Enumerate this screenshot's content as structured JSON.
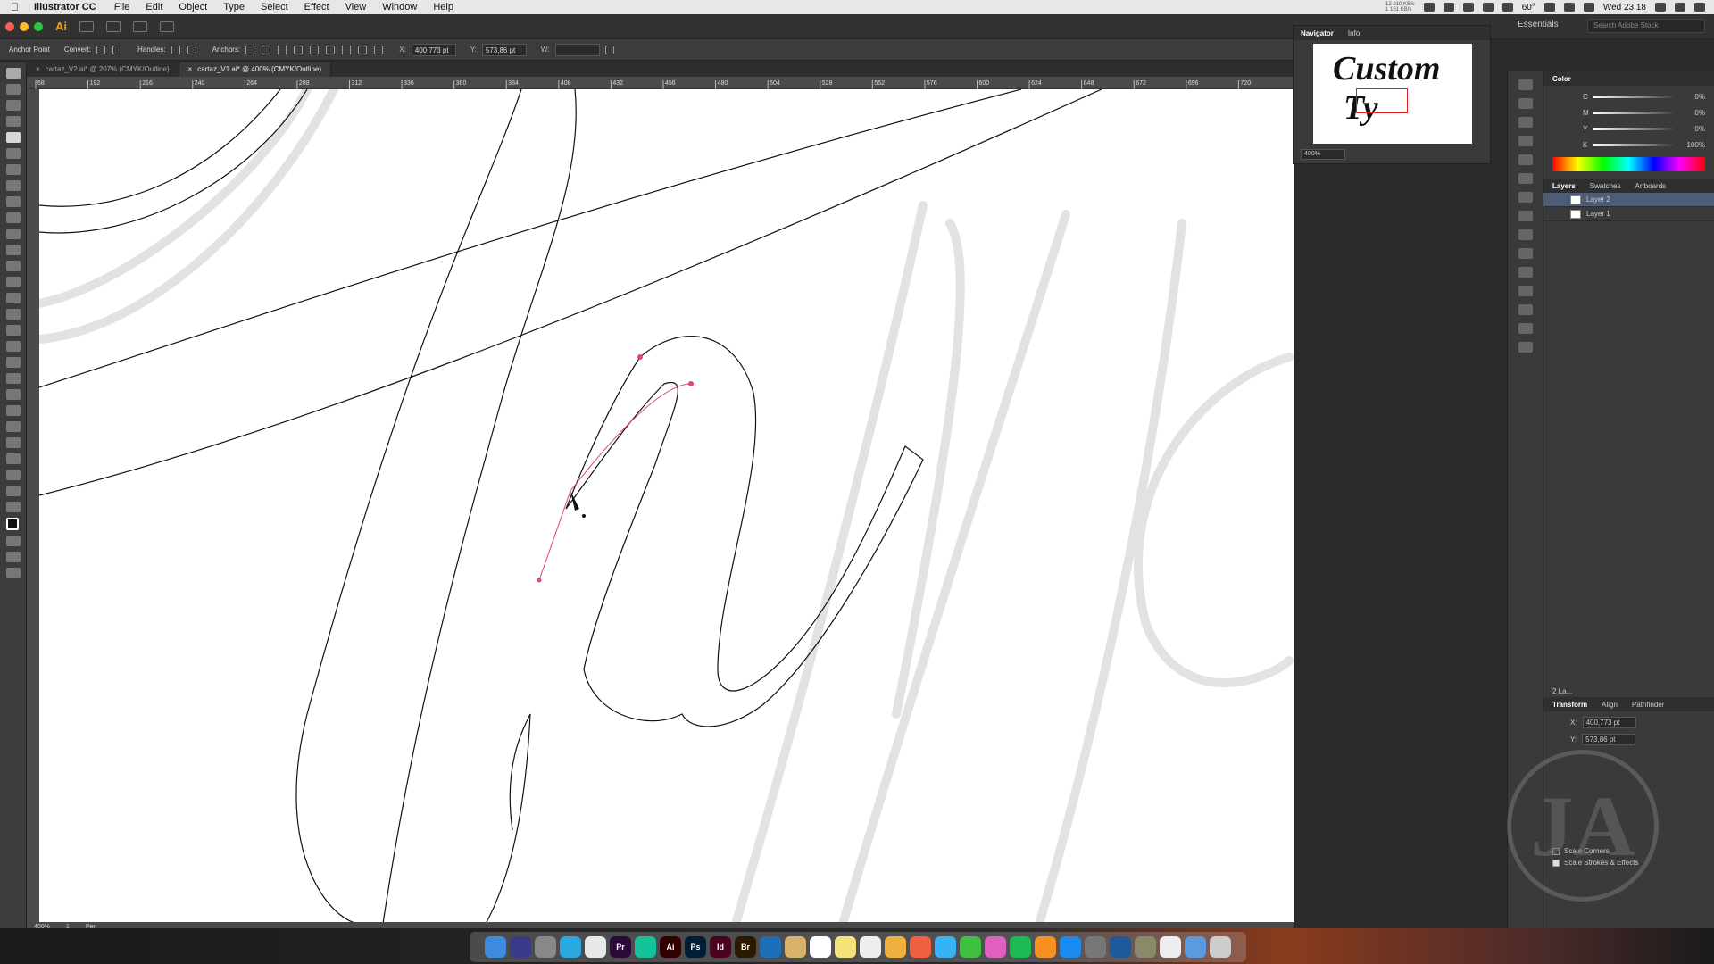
{
  "menubar": {
    "app_name": "Illustrator CC",
    "items": [
      "File",
      "Edit",
      "Object",
      "Type",
      "Select",
      "Effect",
      "View",
      "Window",
      "Help"
    ],
    "clock": "Wed 23:18",
    "temp": "60°",
    "net_up": "12 210 KB/s",
    "net_down": "1 151 KB/s"
  },
  "appbar": {
    "logo": "Ai",
    "workspace": "Essentials",
    "search_placeholder": "Search Adobe Stock"
  },
  "controlbar": {
    "anchor_label": "Anchor Point",
    "convert_label": "Convert:",
    "handles_label": "Handles:",
    "anchors_label": "Anchors:",
    "x_label": "X:",
    "x_value": "400,773 pt",
    "y_label": "Y:",
    "y_value": "573,86 pt",
    "w_label": "W:"
  },
  "tabs": [
    {
      "label": "cartaz_V2.ai* @ 207% (CMYK/Outline)",
      "active": false
    },
    {
      "label": "cartaz_V1.ai* @ 400% (CMYK/Outline)",
      "active": true
    }
  ],
  "ruler": {
    "ticks": [
      "68",
      "192",
      "216",
      "240",
      "264",
      "288",
      "312",
      "336",
      "360",
      "384",
      "408",
      "432",
      "456",
      "480",
      "504",
      "528",
      "552",
      "576",
      "600",
      "624",
      "648",
      "672",
      "696",
      "720"
    ]
  },
  "navigator": {
    "tabs": [
      "Navigator",
      "Info"
    ],
    "preview_text_1": "Custom",
    "preview_text_2": "Ty",
    "zoom": "400%"
  },
  "color_panel": {
    "title": "Color",
    "rows": [
      {
        "label": "C",
        "value": "0"
      },
      {
        "label": "M",
        "value": "0"
      },
      {
        "label": "Y",
        "value": "0"
      },
      {
        "label": "K",
        "value": "100"
      }
    ],
    "percent": "%"
  },
  "layers_panel": {
    "tabs": [
      "Layers",
      "Swatches",
      "Artboards"
    ],
    "layers": [
      {
        "name": "Layer 2",
        "selected": true
      },
      {
        "name": "Layer 1",
        "selected": false
      }
    ],
    "count": "2 La..."
  },
  "transform_panel": {
    "tabs": [
      "Transform",
      "Align",
      "Pathfinder"
    ],
    "x_label": "X:",
    "x_value": "400,773 pt",
    "y_label": "Y:",
    "y_value": "573,86 pt",
    "scale_corners": "Scale Corners",
    "scale_strokes": "Scale Strokes & Effects"
  },
  "statusbar": {
    "zoom": "400%",
    "artboard": "1",
    "tool": "Pen"
  },
  "watermark": {
    "glyph": "JA"
  },
  "colors": {
    "anchor_red": "#e0447a",
    "accent_orange": "#ff9a00",
    "ps_blue": "#2fa3f7",
    "id_pink": "#ff3d8b"
  },
  "dock": [
    {
      "name": "finder-icon",
      "bg": "#3d8bdf",
      "text": ""
    },
    {
      "name": "siri-icon",
      "bg": "#3a3a8a",
      "text": ""
    },
    {
      "name": "launchpad-icon",
      "bg": "#888888",
      "text": ""
    },
    {
      "name": "safari-icon",
      "bg": "#2aa8e0",
      "text": ""
    },
    {
      "name": "chrome-icon",
      "bg": "#e8e8e8",
      "text": ""
    },
    {
      "name": "premiere-icon",
      "bg": "#2a0a3a",
      "text": "Pr"
    },
    {
      "name": "grammarly-icon",
      "bg": "#15c39a",
      "text": ""
    },
    {
      "name": "illustrator-icon",
      "bg": "#330000",
      "text": "Ai"
    },
    {
      "name": "photoshop-icon",
      "bg": "#001e36",
      "text": "Ps"
    },
    {
      "name": "indesign-icon",
      "bg": "#49021f",
      "text": "Id"
    },
    {
      "name": "bridge-icon",
      "bg": "#2a1a00",
      "text": "Br"
    },
    {
      "name": "edge-icon",
      "bg": "#1d6fb8",
      "text": ""
    },
    {
      "name": "file-icon",
      "bg": "#d8b26a",
      "text": ""
    },
    {
      "name": "calendar-icon",
      "bg": "#ffffff",
      "text": ""
    },
    {
      "name": "notes-icon",
      "bg": "#f6e27a",
      "text": ""
    },
    {
      "name": "reminders-icon",
      "bg": "#eeeeee",
      "text": ""
    },
    {
      "name": "photos-icon",
      "bg": "#f0b040",
      "text": ""
    },
    {
      "name": "photos2-icon",
      "bg": "#ee6040",
      "text": ""
    },
    {
      "name": "messages-icon",
      "bg": "#36b3f5",
      "text": ""
    },
    {
      "name": "facetime-icon",
      "bg": "#40c040",
      "text": ""
    },
    {
      "name": "itunes-icon",
      "bg": "#e060c0",
      "text": ""
    },
    {
      "name": "spotify-icon",
      "bg": "#1db954",
      "text": ""
    },
    {
      "name": "books-icon",
      "bg": "#f79021",
      "text": ""
    },
    {
      "name": "appstore-icon",
      "bg": "#1a8cf0",
      "text": ""
    },
    {
      "name": "prefs-icon",
      "bg": "#777777",
      "text": ""
    },
    {
      "name": "virtualbox-icon",
      "bg": "#1e5a9a",
      "text": ""
    },
    {
      "name": "automator-icon",
      "bg": "#8a8a6a",
      "text": ""
    },
    {
      "name": "doc-icon",
      "bg": "#eeeeee",
      "text": ""
    },
    {
      "name": "screen-icon",
      "bg": "#5a9adf",
      "text": ""
    },
    {
      "name": "trash-icon",
      "bg": "#cccccc",
      "text": ""
    }
  ]
}
